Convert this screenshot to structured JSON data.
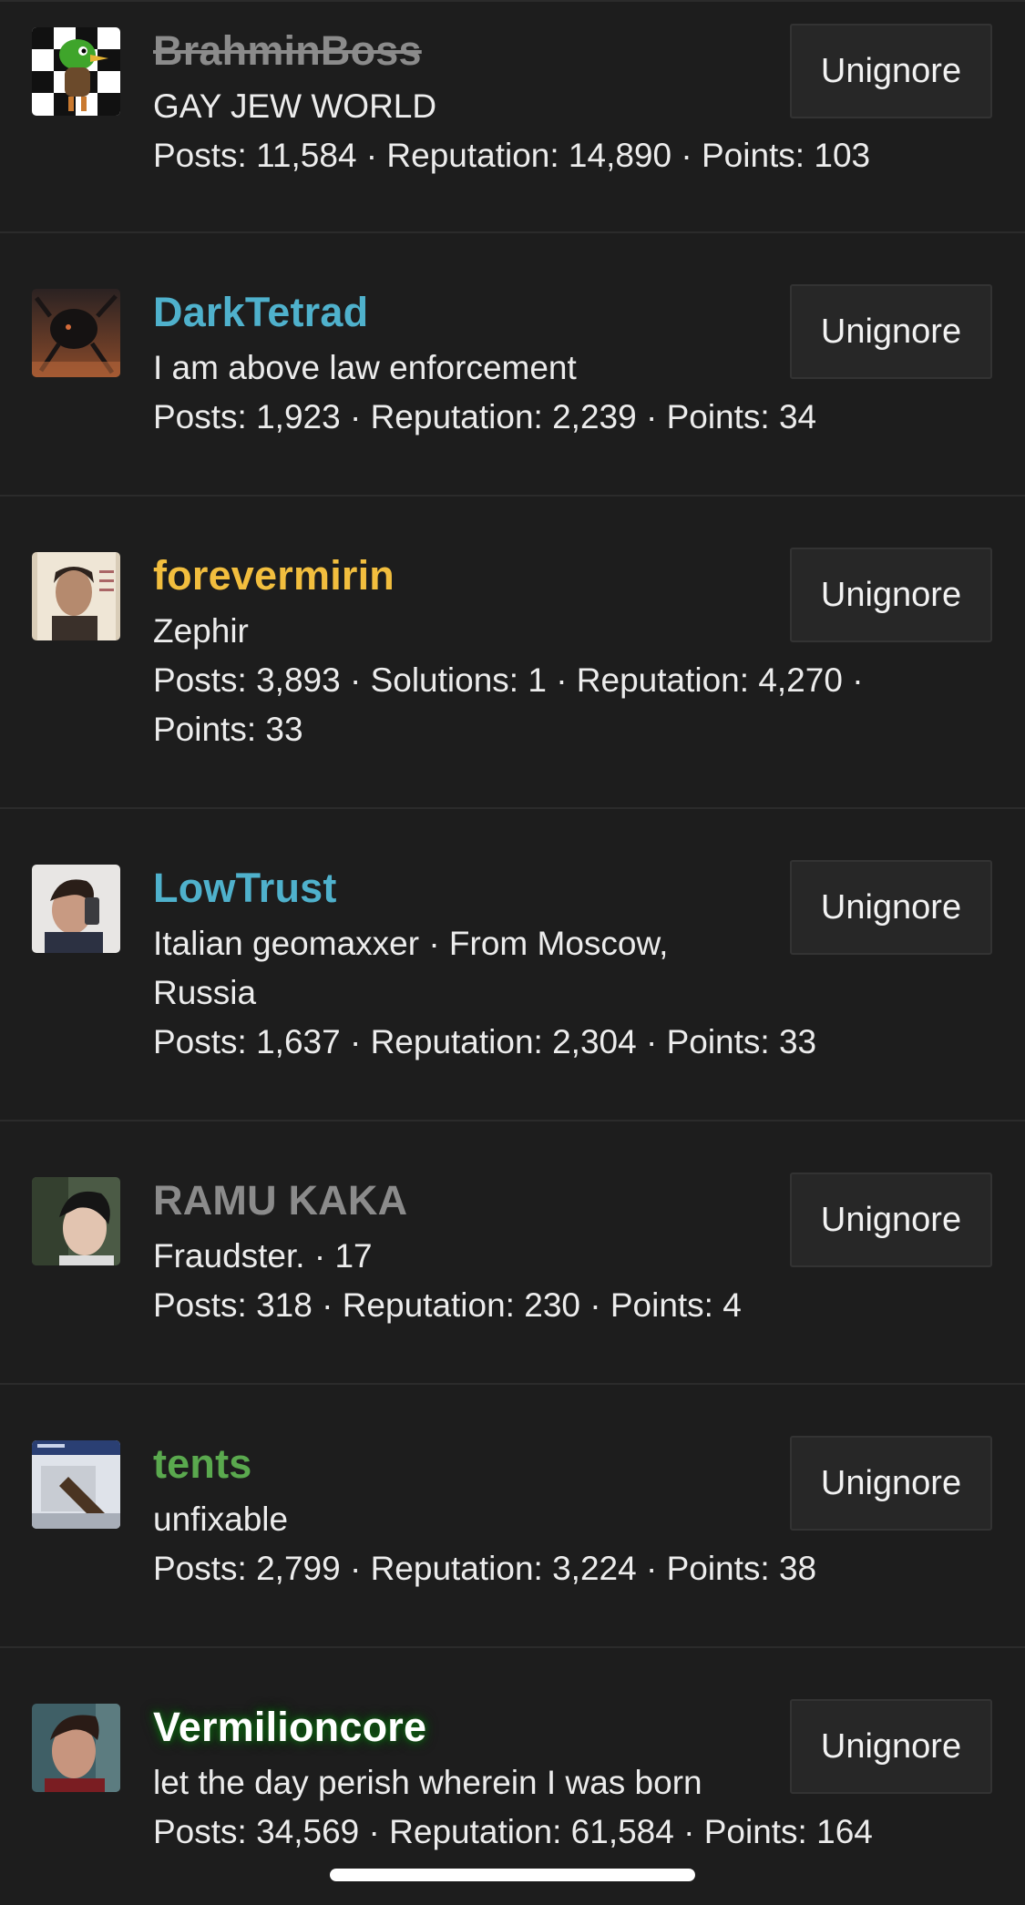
{
  "colors": {
    "background": "#1d1d1d",
    "divider": "#2b2b2b",
    "button_bg": "#272727",
    "name_gray": "#8b8b8b",
    "name_blue": "#4fb1cc",
    "name_gold": "#f2be3e",
    "name_green": "#5aa94e",
    "name_white_glow": "#ffffff"
  },
  "users": [
    {
      "name": "BrahminBoss",
      "name_color": "#8b8b8b",
      "avatar_icon": "duck-avatar",
      "lines": [
        "GAY JEW WORLD",
        "Posts: 11,584 · Reputation: 14,890 · Points: 103"
      ],
      "button": "Unignore"
    },
    {
      "name": "DarkTetrad",
      "name_color": "#4fb1cc",
      "avatar_icon": "dark-creature-avatar",
      "lines": [
        "I am above law enforcement",
        "Posts: 1,923 · Reputation: 2,239 · Points: 34"
      ],
      "button": "Unignore"
    },
    {
      "name": "forevermirin",
      "name_color": "#f2be3e",
      "avatar_icon": "portrait-card-avatar",
      "lines": [
        "Zephir",
        "Posts: 3,893 · Solutions: 1 · Reputation: 4,270 ·",
        "Points: 33"
      ],
      "button": "Unignore"
    },
    {
      "name": "LowTrust",
      "name_color": "#4fb1cc",
      "avatar_icon": "mirror-selfie-avatar",
      "lines": [
        "Italian geomaxxer · From Moscow,",
        "Russia",
        "Posts: 1,637 · Reputation: 2,304 · Points: 33"
      ],
      "button": "Unignore"
    },
    {
      "name": "RAMU KAKA",
      "name_color": "#8b8b8b",
      "avatar_icon": "face-avatar",
      "lines": [
        "Fraudster. · 17",
        "Posts: 318 · Reputation: 230 · Points: 4"
      ],
      "button": "Unignore"
    },
    {
      "name": "tents",
      "name_color": "#5aa94e",
      "avatar_icon": "screen-photo-avatar",
      "lines": [
        "unfixable",
        "Posts: 2,799 · Reputation: 3,224 · Points: 38"
      ],
      "button": "Unignore"
    },
    {
      "name": "Vermilioncore",
      "name_color": "#ffffff",
      "avatar_icon": "man-portrait-avatar",
      "lines": [
        "let the day perish wherein I was born",
        "Posts: 34,569 · Reputation: 61,584 · Points: 164"
      ],
      "button": "Unignore"
    }
  ]
}
